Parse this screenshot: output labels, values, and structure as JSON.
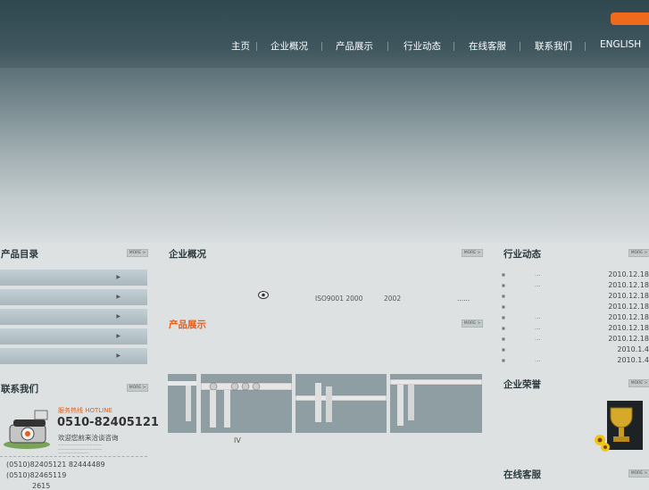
{
  "nav": {
    "items": [
      "主页",
      "企业概况",
      "产品展示",
      "行业动态",
      "在线客服",
      "联系我们",
      "ENGLISH"
    ]
  },
  "more_label": "MORE >",
  "product_catalog": {
    "title": "产品目录"
  },
  "contact": {
    "title": "联系我们",
    "hotline_label": "服务热线 HOTLINE",
    "hotline_number": "0510-82405121",
    "welcome": "欢迎您前来洽谈咨询",
    "line1": "(0510)82405121 82444489",
    "line2": "(0510)82465119",
    "line3": "2615"
  },
  "company_profile": {
    "title": "企业概况",
    "iso": "ISO9001 2000",
    "year": "2002",
    "ellipsis": "......"
  },
  "product_show": {
    "title": "产品展示",
    "caption": "IV"
  },
  "industry_news": {
    "title": "行业动态",
    "items": [
      {
        "dots": "...",
        "date": "2010.12.18"
      },
      {
        "dots": "...",
        "date": "2010.12.18"
      },
      {
        "dots": "",
        "date": "2010.12.18"
      },
      {
        "dots": "",
        "date": "2010.12.18"
      },
      {
        "dots": "...",
        "date": "2010.12.18"
      },
      {
        "dots": "...",
        "date": "2010.12.18"
      },
      {
        "dots": "...",
        "date": "2010.12.18"
      },
      {
        "dots": "",
        "date": "2010.1.4"
      },
      {
        "dots": "...",
        "date": "2010.1.4"
      }
    ]
  },
  "honors": {
    "title": "企业荣誉"
  },
  "online_service": {
    "title": "在线客服"
  }
}
